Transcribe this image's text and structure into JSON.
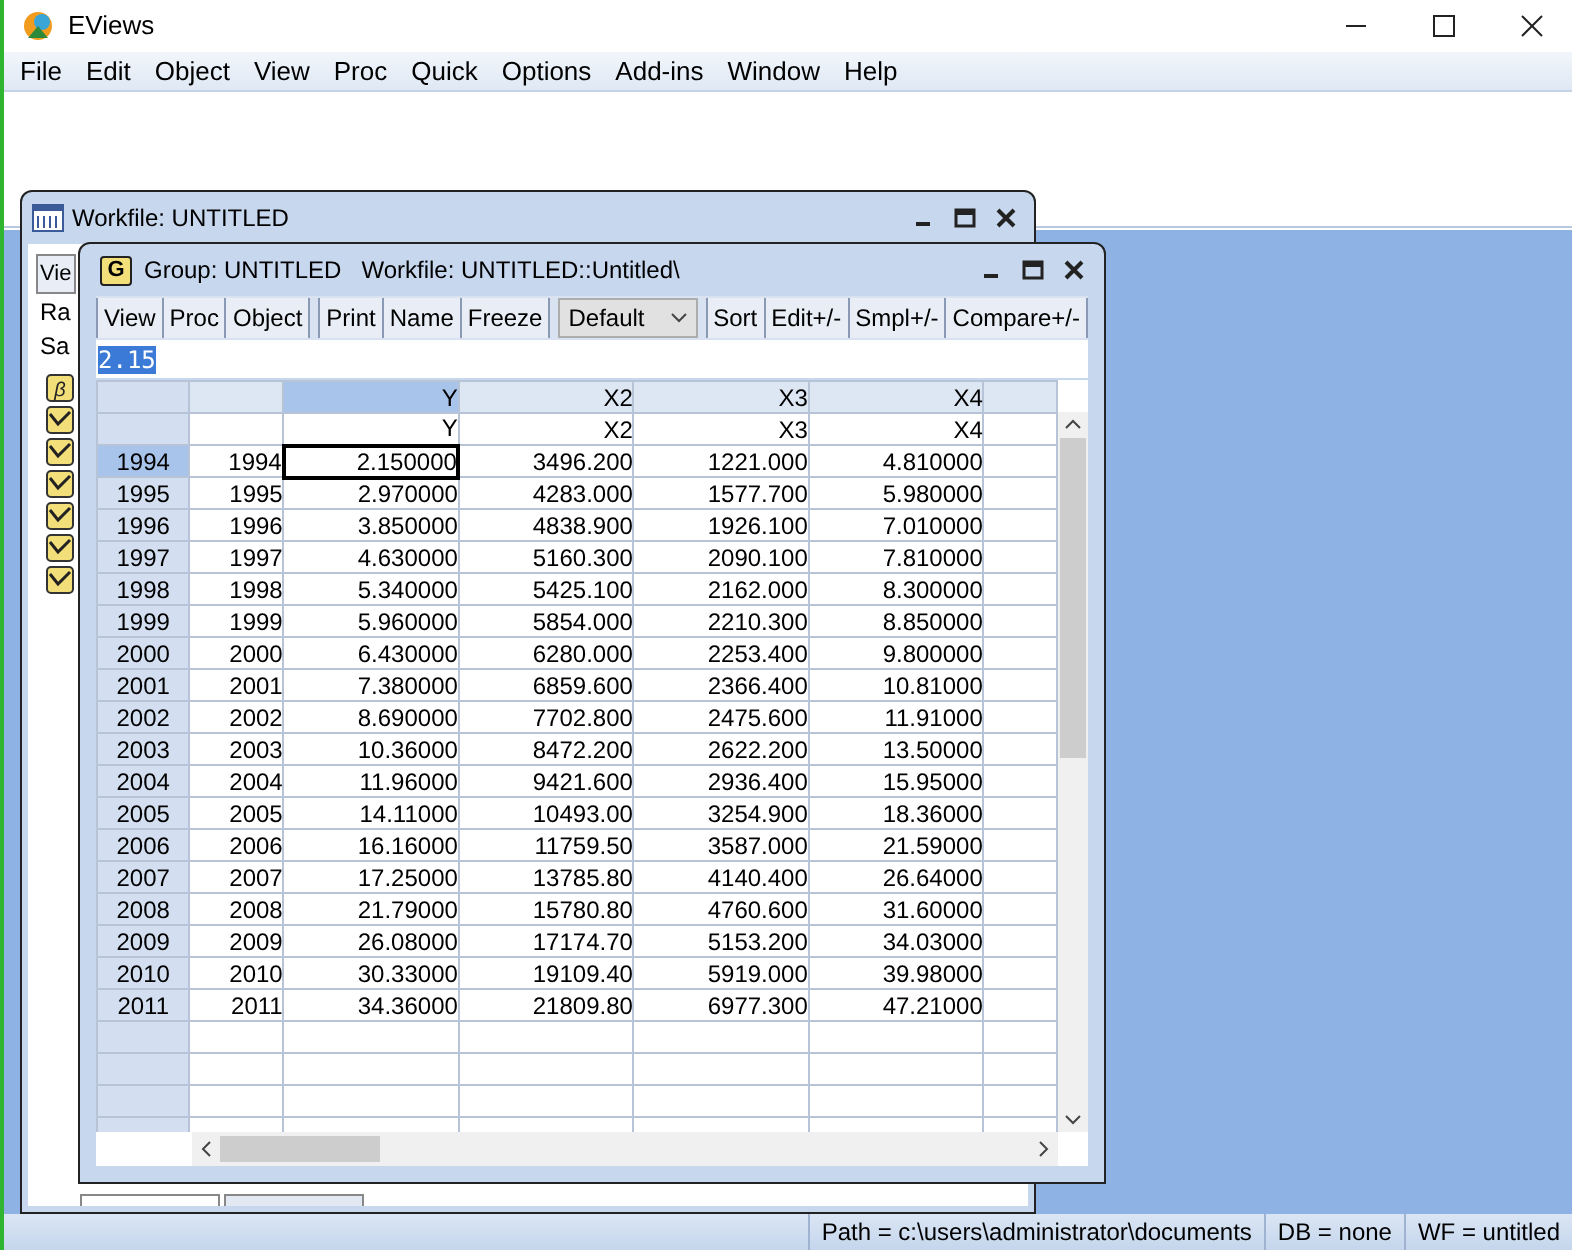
{
  "app": {
    "title": "EViews",
    "menu": [
      "File",
      "Edit",
      "Object",
      "View",
      "Proc",
      "Quick",
      "Options",
      "Add-ins",
      "Window",
      "Help"
    ]
  },
  "workfile_window": {
    "title": "Workfile: UNTITLED",
    "button": "Vie",
    "labels": [
      "Ra",
      "Sa"
    ],
    "objects": [
      {
        "kind": "coef",
        "glyph": "β"
      },
      {
        "kind": "series"
      },
      {
        "kind": "series"
      },
      {
        "kind": "series"
      },
      {
        "kind": "series"
      },
      {
        "kind": "series"
      },
      {
        "kind": "series"
      }
    ]
  },
  "group_window": {
    "icon_letter": "G",
    "title": "Group: UNTITLED",
    "subtitle": "Workfile: UNTITLED::Untitled\\",
    "toolbar": [
      [
        "View",
        "Proc",
        "Object"
      ],
      [
        "Print",
        "Name",
        "Freeze"
      ]
    ],
    "dropdown": {
      "value": "Default"
    },
    "toolbar_right": [
      "Sort",
      "Edit+/-",
      "Smpl+/-",
      "Compare+/-"
    ],
    "edit_value": "2.15",
    "columns": [
      {
        "selected": false
      },
      {
        "header": "Y",
        "subheader": "Y",
        "selected": true
      },
      {
        "header": "X2",
        "subheader": "X2",
        "selected": false
      },
      {
        "header": "X3",
        "subheader": "X3",
        "selected": false
      },
      {
        "header": "X4",
        "subheader": "X4",
        "selected": false
      }
    ],
    "rows": [
      {
        "header": "1994",
        "selected": true,
        "cells": [
          "1994",
          "2.150000",
          "3496.200",
          "1221.000",
          "4.810000"
        ]
      },
      {
        "header": "1995",
        "selected": false,
        "cells": [
          "1995",
          "2.970000",
          "4283.000",
          "1577.700",
          "5.980000"
        ]
      },
      {
        "header": "1996",
        "selected": false,
        "cells": [
          "1996",
          "3.850000",
          "4838.900",
          "1926.100",
          "7.010000"
        ]
      },
      {
        "header": "1997",
        "selected": false,
        "cells": [
          "1997",
          "4.630000",
          "5160.300",
          "2090.100",
          "7.810000"
        ]
      },
      {
        "header": "1998",
        "selected": false,
        "cells": [
          "1998",
          "5.340000",
          "5425.100",
          "2162.000",
          "8.300000"
        ]
      },
      {
        "header": "1999",
        "selected": false,
        "cells": [
          "1999",
          "5.960000",
          "5854.000",
          "2210.300",
          "8.850000"
        ]
      },
      {
        "header": "2000",
        "selected": false,
        "cells": [
          "2000",
          "6.430000",
          "6280.000",
          "2253.400",
          "9.800000"
        ]
      },
      {
        "header": "2001",
        "selected": false,
        "cells": [
          "2001",
          "7.380000",
          "6859.600",
          "2366.400",
          "10.81000"
        ]
      },
      {
        "header": "2002",
        "selected": false,
        "cells": [
          "2002",
          "8.690000",
          "7702.800",
          "2475.600",
          "11.91000"
        ]
      },
      {
        "header": "2003",
        "selected": false,
        "cells": [
          "2003",
          "10.36000",
          "8472.200",
          "2622.200",
          "13.50000"
        ]
      },
      {
        "header": "2004",
        "selected": false,
        "cells": [
          "2004",
          "11.96000",
          "9421.600",
          "2936.400",
          "15.95000"
        ]
      },
      {
        "header": "2005",
        "selected": false,
        "cells": [
          "2005",
          "14.11000",
          "10493.00",
          "3254.900",
          "18.36000"
        ]
      },
      {
        "header": "2006",
        "selected": false,
        "cells": [
          "2006",
          "16.16000",
          "11759.50",
          "3587.000",
          "21.59000"
        ]
      },
      {
        "header": "2007",
        "selected": false,
        "cells": [
          "2007",
          "17.25000",
          "13785.80",
          "4140.400",
          "26.64000"
        ]
      },
      {
        "header": "2008",
        "selected": false,
        "cells": [
          "2008",
          "21.79000",
          "15780.80",
          "4760.600",
          "31.60000"
        ]
      },
      {
        "header": "2009",
        "selected": false,
        "cells": [
          "2009",
          "26.08000",
          "17174.70",
          "5153.200",
          "34.03000"
        ]
      },
      {
        "header": "2010",
        "selected": false,
        "cells": [
          "2010",
          "30.33000",
          "19109.40",
          "5919.000",
          "39.98000"
        ]
      },
      {
        "header": "2011",
        "selected": false,
        "cells": [
          "2011",
          "34.36000",
          "21809.80",
          "6977.300",
          "47.21000"
        ]
      }
    ]
  },
  "status_bar": [
    "Path = c:\\users\\administrator\\documents",
    "DB = none",
    "WF = untitled"
  ]
}
